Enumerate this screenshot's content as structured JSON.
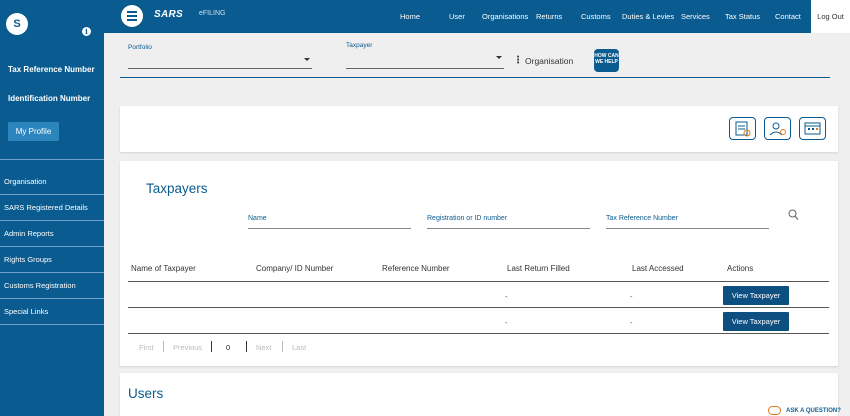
{
  "sidebar": {
    "avatar_initial": "S",
    "info_glyph": "i",
    "tax_ref_label": "Tax Reference Number",
    "id_label": "Identification Number",
    "profile_button": "My Profile",
    "items": [
      {
        "label": "Organisation"
      },
      {
        "label": "SARS Registered Details"
      },
      {
        "label": "Admin Reports"
      },
      {
        "label": "Rights Groups"
      },
      {
        "label": "Customs Registration"
      },
      {
        "label": "Special Links"
      }
    ]
  },
  "topbar": {
    "brand": "SARS",
    "brand_sub": "eFILING",
    "nav": [
      "Home",
      "User",
      "Organisations",
      "Returns",
      "Customs",
      "Duties & Levies",
      "Services",
      "Tax Status",
      "Contact"
    ],
    "logout": "Log Out"
  },
  "filters": {
    "portfolio_label": "Portfolio",
    "taxpayer_label": "Taxpayer",
    "context": "Organisation",
    "help_badge": "HOW CAN WE HELP"
  },
  "taxpayers": {
    "title": "Taxpayers",
    "search_fields": [
      "Name",
      "Registration or ID number",
      "Tax Reference Number"
    ],
    "columns": [
      "Name of Taxpayer",
      "Company/ ID Number",
      "Reference Number",
      "Last Return Filled",
      "Last Accessed",
      "Actions"
    ],
    "rows": [
      {
        "last_return": "-",
        "last_accessed": "-",
        "action": "View Taxpayer"
      },
      {
        "last_return": "-",
        "last_accessed": "-",
        "action": "View Taxpayer"
      }
    ],
    "pager": {
      "first": "First",
      "previous": "Previous",
      "page": "0",
      "next": "Next",
      "last": "Last"
    }
  },
  "users": {
    "title": "Users"
  },
  "help": {
    "ask": "ASK A QUESTION?"
  },
  "colors": {
    "brand": "#0a5b8f",
    "button": "#0d4f80",
    "accent": "#e07b1e"
  }
}
